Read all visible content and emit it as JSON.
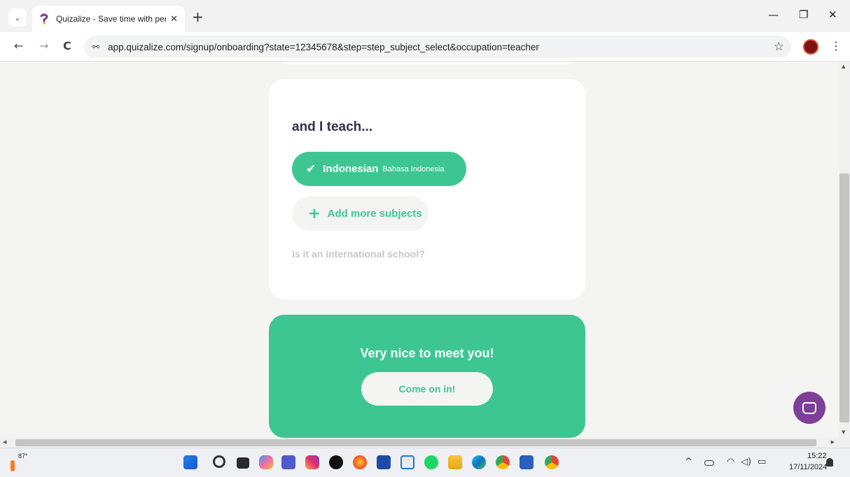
{
  "browser": {
    "tab_title": "Quizalize - Save time with perso",
    "tab_close": "✕",
    "new_tab": "+",
    "tab_dropdown": "⌄",
    "url": "app.quizalize.com/signup/onboarding?state=12345678&step=step_subject_select&occupation=teacher",
    "site_info": "⚯",
    "back": "←",
    "forward": "→",
    "reload": "C",
    "bookmark": "☆",
    "menu": "⋮",
    "minimize": "—",
    "restore": "❐",
    "close": "✕"
  },
  "form": {
    "heading": "and I teach...",
    "selected_subject": {
      "icon": "check-icon",
      "name": "Indonesian",
      "native": "Bahasa Indonesia"
    },
    "add_subjects_label": "Add more subjects",
    "international_question": "Is it an international school?"
  },
  "cta": {
    "title": "Very nice to meet you!",
    "button_label": "Come on in!"
  },
  "taskbar": {
    "temperature": "87°",
    "time": "15:22",
    "date": "17/11/2024",
    "tray_icons": [
      "chevron-up-icon",
      "onedrive-icon",
      "wifi-icon",
      "volume-icon",
      "battery-icon"
    ]
  },
  "colors": {
    "accent_green": "#3dc692",
    "heading_purple": "#3a2d4a",
    "chat_purple": "#7d3f98",
    "page_bg": "#f4f4f2"
  },
  "glyphs": {
    "check": "✔",
    "plus": "+",
    "scroll_up": "▲",
    "scroll_down": "▼",
    "scroll_left": "◀",
    "scroll_right": "▶",
    "tray_chevron": "^",
    "tray_wifi": "◠",
    "tray_volume": "◁)",
    "tray_battery": "▭"
  }
}
